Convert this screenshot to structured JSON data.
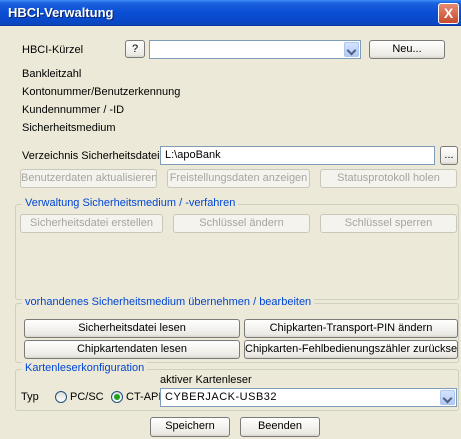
{
  "window": {
    "title": "HBCI-Verwaltung",
    "close_symbol": "X"
  },
  "header": {
    "kuerzel_label": "HBCI-Kürzel",
    "help_label": "?",
    "kuerzel_value": "",
    "new_button": "Neu...",
    "bankleitzahl_label": "Bankleitzahl",
    "konto_label": "Kontonummer/Benutzerkennung",
    "kunden_label": "Kundennummer / -ID",
    "medium_label": "Sicherheitsmedium"
  },
  "files": {
    "dir_label": "Verzeichnis Sicherheitsdateien",
    "dir_value": "L:\\apoBank",
    "browse_label": "...",
    "update_button": "Benutzerdaten aktualisieren",
    "freistellung_button": "Freistellungsdaten anzeigen",
    "status_button": "Statusprotokoll holen"
  },
  "admin_group": {
    "legend": "Verwaltung Sicherheitsmedium / -verfahren",
    "create_button": "Sicherheitsdatei erstellen",
    "change_key_button": "Schlüssel ändern",
    "lock_key_button": "Schlüssel sperren"
  },
  "existing_group": {
    "legend": "vorhandenes Sicherheitsmedium übernehmen / bearbeiten",
    "read_file_button": "Sicherheitsdatei lesen",
    "change_pin_button": "Chipkarten-Transport-PIN ändern",
    "read_card_button": "Chipkartendaten lesen",
    "reset_counter_button": "Chipkarten-Fehlbedienungszähler zurücksetzen"
  },
  "reader_group": {
    "legend": "Kartenleserkonfiguration",
    "typ_label": "Typ",
    "option_pcsc": "PC/SC",
    "option_ctapi": "CT-API",
    "selected_option": "CT-API",
    "active_reader_label": "aktiver Kartenleser",
    "active_reader_value": "CYBERJACK-USB32"
  },
  "footer": {
    "save_button": "Speichern",
    "exit_button": "Beenden"
  },
  "colors": {
    "titlebar": "#0a4ed4",
    "group_legend": "#0046d5",
    "radio_selected": "#21a121",
    "disabled_text": "#a6a69c"
  }
}
